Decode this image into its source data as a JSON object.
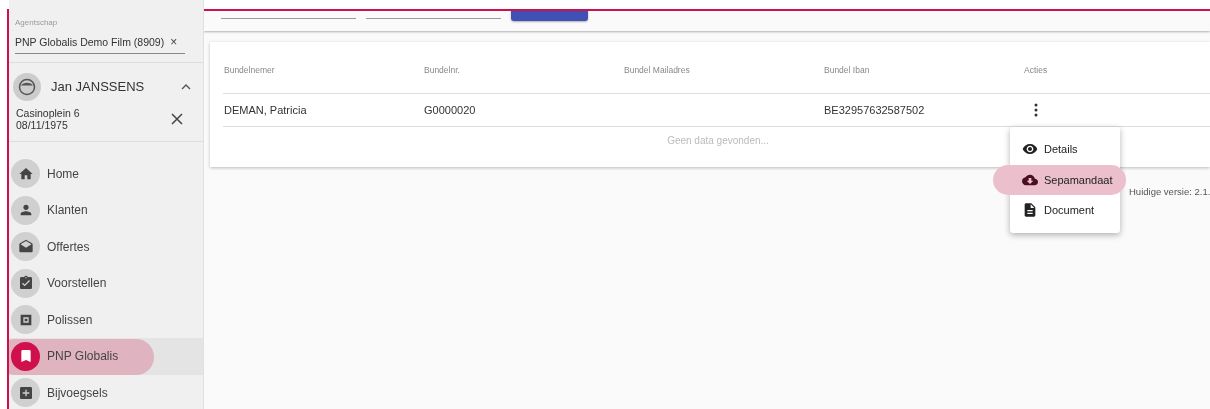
{
  "sidebar": {
    "agency": {
      "label": "Agentschap",
      "value": "PNP Globalis Demo Film (8909)",
      "clear": "×"
    },
    "customer": {
      "name": "Jan JANSSENS",
      "expanded": true,
      "address": "Casinoplein 6",
      "birthdate": "08/11/1975"
    },
    "items": [
      {
        "label": "Home",
        "selected": false
      },
      {
        "label": "Klanten",
        "selected": false
      },
      {
        "label": "Offertes",
        "selected": false
      },
      {
        "label": "Voorstellen",
        "selected": false
      },
      {
        "label": "Polissen",
        "selected": false
      },
      {
        "label": "PNP Globalis",
        "selected": true
      },
      {
        "label": "Bijvoegsels",
        "selected": false
      }
    ]
  },
  "table": {
    "columns": [
      "Bundelnemer",
      "Bundelnr.",
      "Bundel Mailadres",
      "Bundel Iban",
      "Acties"
    ],
    "rows": [
      {
        "cells": [
          "DEMAN, Patricia",
          "G0000020",
          "",
          "BE32957632587502"
        ]
      }
    ],
    "empty_message": "Geen data gevonden..."
  },
  "action_menu": {
    "items": [
      {
        "label": "Details",
        "selected": false
      },
      {
        "label": "Sepamandaat",
        "selected": true
      },
      {
        "label": "Document",
        "selected": false
      }
    ]
  },
  "version": "Huidige versie: 2.1."
}
